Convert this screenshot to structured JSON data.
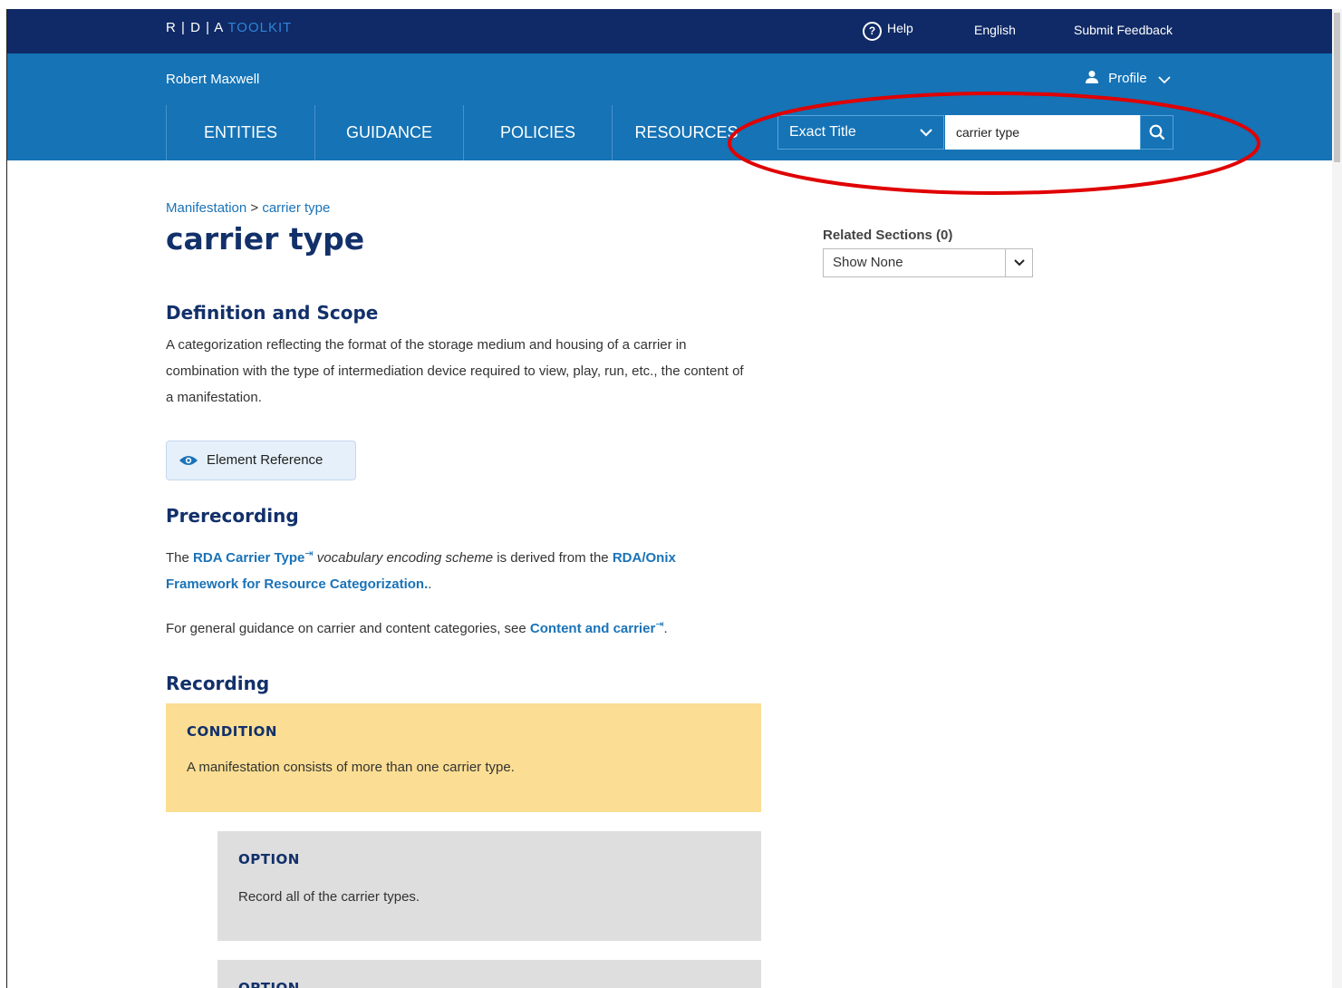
{
  "topbar": {
    "logo_main": "R | D | A",
    "logo_sub": "TOOLKIT",
    "help_glyph": "?",
    "help": "Help",
    "language": "English",
    "feedback": "Submit Feedback"
  },
  "userbar": {
    "username": "Robert Maxwell",
    "profile": "Profile"
  },
  "nav": {
    "items": [
      "ENTITIES",
      "GUIDANCE",
      "POLICIES",
      "RESOURCES"
    ]
  },
  "search": {
    "mode": "Exact Title",
    "query": "carrier type"
  },
  "breadcrumb": {
    "parent": "Manifestation",
    "separator": ">",
    "current": "carrier type"
  },
  "page": {
    "title": "carrier type"
  },
  "definition": {
    "heading": "Definition and Scope",
    "text": "A categorization reflecting the format of the storage medium and housing of a carrier in combination with the type of intermediation device required to view, play, run, etc., the content of a manifestation."
  },
  "element_reference": "Element Reference",
  "prerecording": {
    "heading": "Prerecording",
    "p1_start": "The",
    "p1_link1": "RDA Carrier Type",
    "p1_vocab": "vocabulary encoding scheme",
    "p1_mid": "is derived from the",
    "p1_link2": "RDA/Onix Framework for Resource Categorization.",
    "p1_end": ".",
    "p2_start": "For general guidance on carrier and content categories, see",
    "p2_link": "Content and carrier",
    "p2_end": "."
  },
  "recording": {
    "heading": "Recording",
    "condition_label": "CONDITION",
    "condition_text": "A manifestation consists of more than one carrier type.",
    "options": [
      {
        "label": "OPTION",
        "text": "Record all of the carrier types."
      },
      {
        "label": "OPTION",
        "text": ""
      }
    ]
  },
  "related": {
    "label": "Related Sections (0)",
    "value": "Show None"
  },
  "colors": {
    "topbar": "#0f2a66",
    "bluebar": "#1573b6",
    "heading": "#12306a",
    "link": "#1a73b8",
    "condition_bg": "#fbde93",
    "option_bg": "#dedede",
    "annotation": "#e00000"
  },
  "icons": {
    "help": "question-circle-icon",
    "profile": "user-icon",
    "chevron": "chevron-down-icon",
    "search": "magnifier-icon",
    "eye": "eye-icon",
    "external": "external-link-icon"
  }
}
